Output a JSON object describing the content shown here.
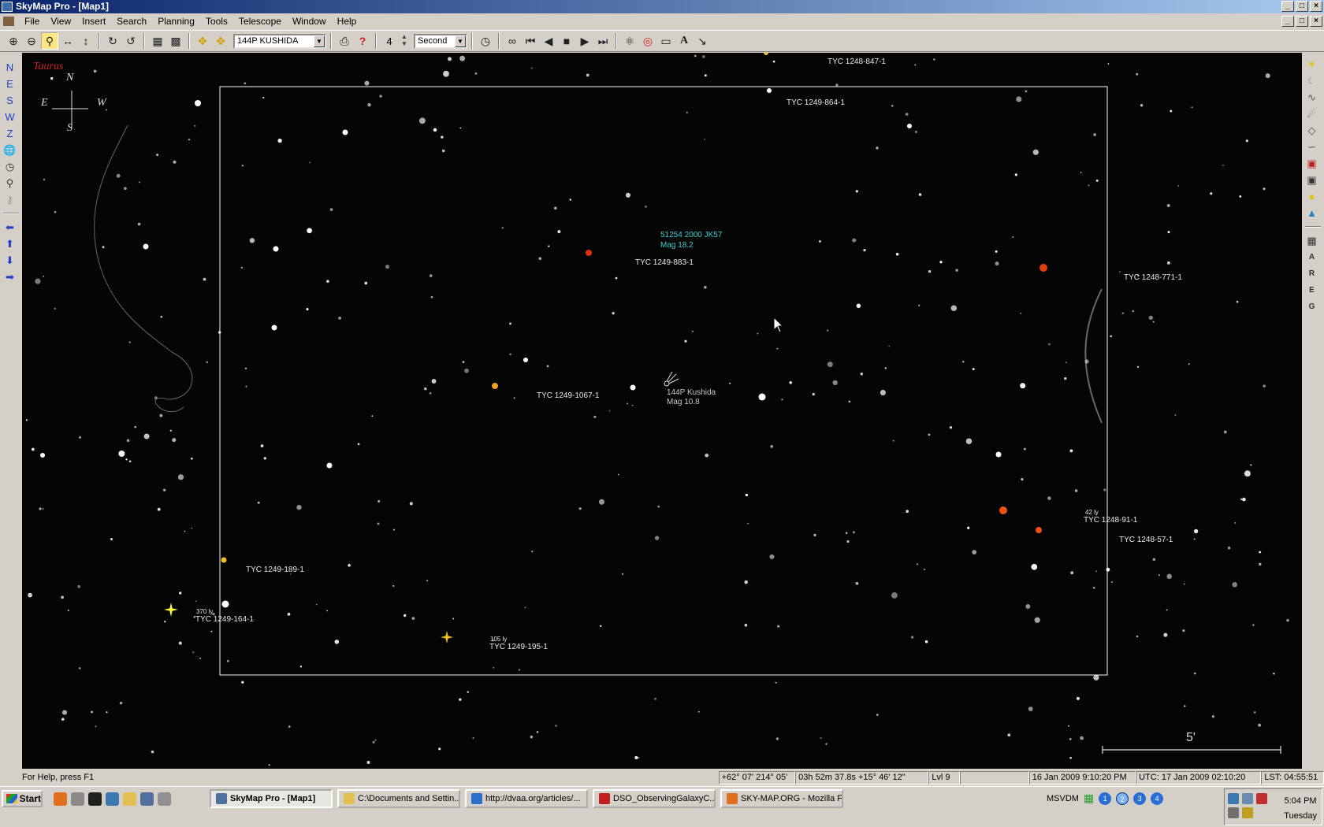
{
  "window": {
    "title": "SkyMap Pro - [Map1]",
    "buttons": [
      "_",
      "□",
      "×"
    ]
  },
  "menu": [
    "File",
    "View",
    "Insert",
    "Search",
    "Planning",
    "Tools",
    "Telescope",
    "Window",
    "Help"
  ],
  "toolbar": {
    "object_combo": "144P KUSHIDA",
    "step_value": "4",
    "unit_combo": "Second"
  },
  "left_toolbar": [
    "N",
    "E",
    "S",
    "W",
    "Z"
  ],
  "right_toolbar_letters": [
    "A",
    "R",
    "E",
    "G"
  ],
  "map": {
    "constellation": "Taurus",
    "compass": {
      "n": "N",
      "s": "S",
      "e": "E",
      "w": "W"
    },
    "comet": {
      "name": "144P Kushida",
      "mag": "Mag 10.8"
    },
    "asteroid": {
      "name": "51254  2000 JK57",
      "mag": "Mag 18.2"
    },
    "scale_label": "5'",
    "star_labels": [
      {
        "name": "TYC 1248-847-1"
      },
      {
        "name": "TYC 1249-864-1"
      },
      {
        "name": "TYC 1249-883-1"
      },
      {
        "name": "TYC 1248-771-1"
      },
      {
        "name": "TYC 1249-1067-1"
      },
      {
        "name": "TYC 1248-91-1"
      },
      {
        "name": "TYC 1248-57-1"
      },
      {
        "name": "TYC 1249-189-1"
      },
      {
        "name": "TYC 1249-164-1"
      },
      {
        "name": "TYC 1249-195-1"
      }
    ],
    "distance_labels": [
      "42 ly",
      "370 ly",
      "105 ly"
    ]
  },
  "status": {
    "help": "For Help, press F1",
    "altaz": "+62° 07'  214° 05'",
    "radec": "03h 52m 37.8s  +15° 46' 12\"",
    "level": "Lvl 9",
    "blank": "",
    "local_time": "16 Jan 2009 9:10:20 PM",
    "utc": "UTC: 17 Jan 2009 02:10:20",
    "lst": "LST: 04:55:51"
  },
  "taskbar": {
    "start": "Start",
    "tasks": [
      "SkyMap Pro - [Map1]",
      "C:\\Documents and Settin...",
      "http://dvaa.org/articles/...",
      "DSO_ObservingGalaxyC...",
      "SKY-MAP.ORG - Mozilla F..."
    ],
    "msvdm": "MSVDM",
    "desktops": [
      "1",
      "2",
      "3",
      "4"
    ],
    "clock": "5:04 PM",
    "day": "Tuesday"
  },
  "colors": {
    "titlebar_start": "#0a246a",
    "sky": "#050505",
    "asteroid_label": "#3ad0d0",
    "constellation_label": "#d02020"
  }
}
